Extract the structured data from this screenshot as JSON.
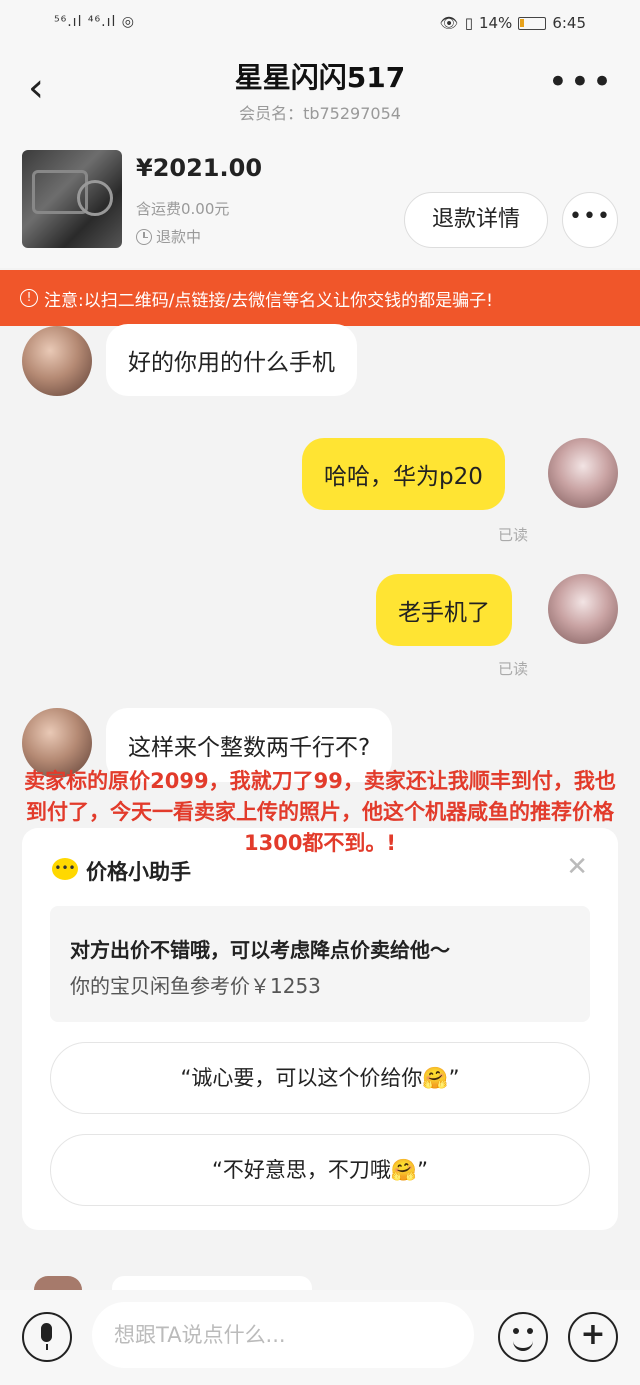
{
  "status_bar": {
    "signal": "⁵⁶.ıl ⁴⁶.ıl ◎",
    "battery": "14%",
    "time": "6:45"
  },
  "header": {
    "title": "星星闪闪517",
    "subtitle": "会员名：tb75297054",
    "back_icon": "‹",
    "more_icon": "•••"
  },
  "product": {
    "price": "¥2021.00",
    "shipping": "含运费0.00元",
    "status": "退款中",
    "refund_button": "退款详情",
    "more_button": "•••"
  },
  "warning": {
    "text": "注意:以扫二维码/点链接/去微信等名义让你交钱的都是骗子!"
  },
  "messages": [
    {
      "side": "left",
      "text": "好的你用的什么手机"
    },
    {
      "side": "right",
      "text": "哈哈，华为p20",
      "status": "已读"
    },
    {
      "side": "right",
      "text": "老手机了",
      "status": "已读"
    },
    {
      "side": "left",
      "text": "这样来个整数两千行不?"
    }
  ],
  "annotation": "卖家标的原价2099，我就刀了99，卖家还让我顺丰到付，我也到付了，今天一看卖家上传的照片，他这个机器咸鱼的推荐价格1300都不到。!",
  "helper": {
    "title": "价格小助手",
    "tip_title": "对方出价不错哦，可以考虑降点价卖给他～",
    "tip_sub": "你的宝贝闲鱼参考价￥1253",
    "option1": "“诚心要，可以这个价给你🤗”",
    "option2": "“不好意思，不刀哦🤗”"
  },
  "input": {
    "placeholder": "想跟TA说点什么..."
  },
  "colors": {
    "warning_bg": "#f0562a",
    "my_bubble": "#ffe433",
    "annotation": "#e23b2b"
  }
}
